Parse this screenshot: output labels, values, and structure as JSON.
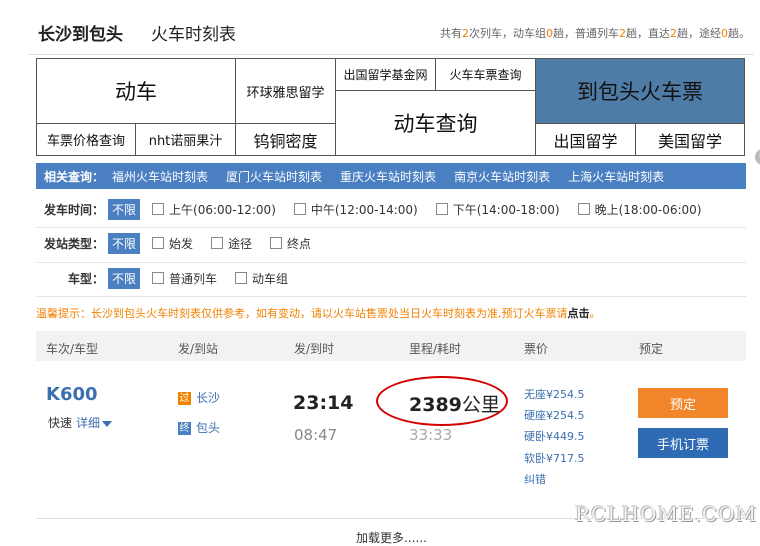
{
  "header": {
    "title": "长沙到包头",
    "subtitle": "火车时刻表",
    "summary": {
      "p1": "共有",
      "total": "2",
      "p2": "次列车，动车组",
      "emu": "0",
      "p3": "趟，普通列车",
      "normal": "2",
      "p4": "趟，直达",
      "direct": "2",
      "p5": "趟，途经",
      "via": "0",
      "p6": "趟。"
    }
  },
  "ads": {
    "a1": "动车",
    "a2": "环球雅思留学",
    "a3": "出国留学基金网",
    "a4": "火车车票查询",
    "a5": "到包头火车票",
    "a6": "车票价格查询",
    "a7": "nht诺丽果汁",
    "a8": "钨铜密度",
    "a9": "动车查询",
    "a10": "出国留学",
    "a11": "美国留学"
  },
  "related": {
    "label": "相关查询：",
    "links": [
      "福州火车站时刻表",
      "厦门火车站时刻表",
      "重庆火车站时刻表",
      "南京火车站时刻表",
      "上海火车站时刻表"
    ]
  },
  "filters": {
    "time": {
      "label": "发车时间：",
      "all": "不限",
      "options": [
        "上午(06:00-12:00)",
        "中午(12:00-14:00)",
        "下午(14:00-18:00)",
        "晚上(18:00-06:00)"
      ]
    },
    "station": {
      "label": "发站类型：",
      "all": "不限",
      "options": [
        "始发",
        "途径",
        "终点"
      ]
    },
    "type": {
      "label": "车型：",
      "all": "不限",
      "options": [
        "普通列车",
        "动车组"
      ]
    }
  },
  "tip": {
    "text": "温馨提示：长沙到包头火车时刻表仅供参考，如有变动，请以火车站售票处当日火车时刻表为准,预订火车票请",
    "link": "点击",
    "end": "。"
  },
  "table": {
    "headers": [
      "车次/车型",
      "发/到站",
      "发/到时",
      "里程/耗时",
      "票价",
      "预定"
    ]
  },
  "train": {
    "number": "K600",
    "type": "快速",
    "detail": "详细",
    "from_badge": "过",
    "from": "长沙",
    "to_badge": "终",
    "to": "包头",
    "depart": "23:14",
    "arrive": "08:47",
    "distance": "2389",
    "distance_unit": "公里",
    "duration": "33:33",
    "prices": [
      "无座¥254.5",
      "硬座¥254.5",
      "硬卧¥449.5",
      "软卧¥717.5"
    ],
    "correction": "纠错",
    "book": "预定",
    "mobile": "手机订票"
  },
  "more": "加载更多......",
  "watermark": "RCLHOME.COM",
  "colors": {
    "blue": "#4a7fc1",
    "orange": "#f0852a",
    "accent_text": "#3a6fb0",
    "annotation": "#d20000"
  }
}
